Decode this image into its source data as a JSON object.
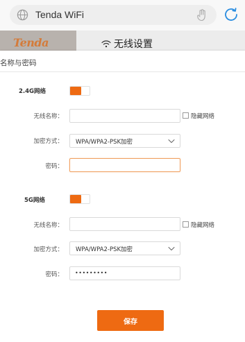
{
  "browser": {
    "url": "Tenda WiFi"
  },
  "header": {
    "logo_text": "Tenda",
    "title": "无线设置"
  },
  "section": {
    "title": "名称与密码"
  },
  "band_24": {
    "label": "2.4G网络",
    "enabled": true,
    "ssid_label": "无线名称：",
    "ssid_value": "",
    "hide_label": "隐藏网络",
    "security_label": "加密方式：",
    "security_value": "WPA/WPA2-PSK加密",
    "password_label": "密码：",
    "password_value": ""
  },
  "band_5": {
    "label": "5G网络",
    "enabled": true,
    "ssid_label": "无线名称：",
    "ssid_value": "",
    "hide_label": "隐藏网络",
    "security_label": "加密方式：",
    "security_value": "WPA/WPA2-PSK加密",
    "password_label": "密码：",
    "password_value": "•••••••••"
  },
  "actions": {
    "save_label": "保存"
  },
  "colors": {
    "accent": "#ee6a12",
    "logo": "#d47b3a",
    "refresh": "#2a8de0"
  }
}
